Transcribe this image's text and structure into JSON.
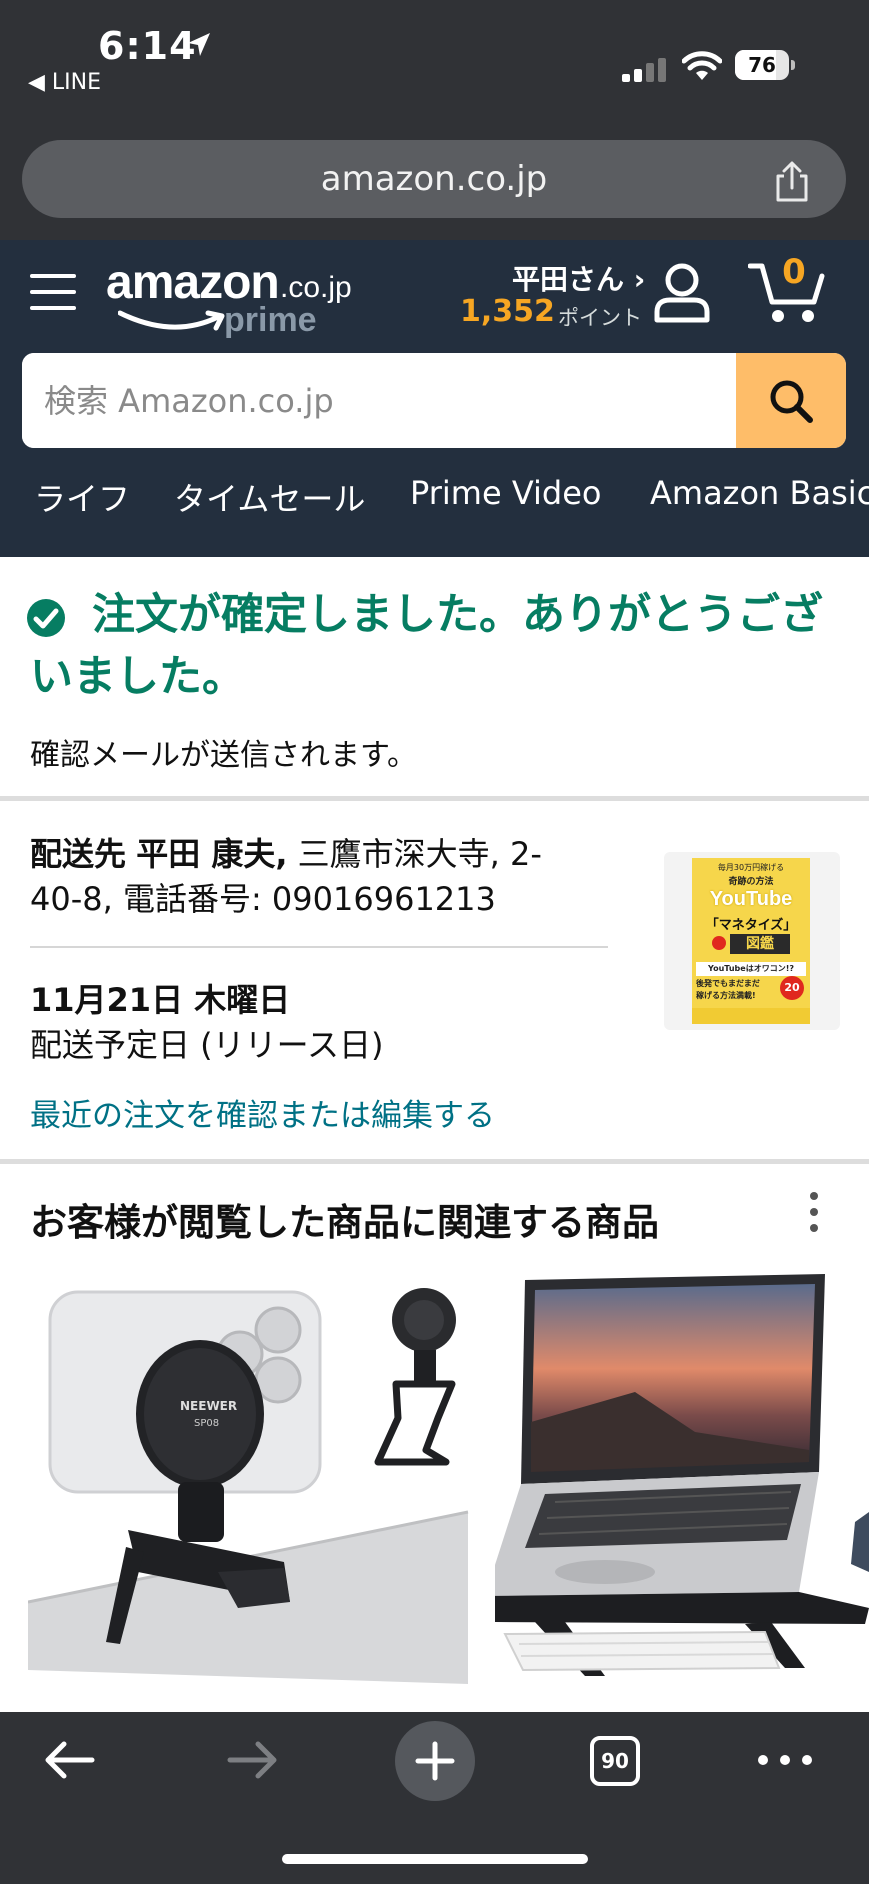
{
  "status_bar": {
    "time": "6:14",
    "back_app": "◀ LINE",
    "battery": "76"
  },
  "browser": {
    "url": "amazon.co.jp",
    "tab_count": "90"
  },
  "header": {
    "logo_main": "amazon",
    "logo_domain": ".co.jp",
    "logo_sub": "prime",
    "user_name": "平田さん ›",
    "points_value": "1,352",
    "points_label": "ポイント",
    "cart_count": "0"
  },
  "search": {
    "placeholder": "検索 Amazon.co.jp"
  },
  "nav": {
    "items": [
      "ライフ",
      "タイムセール",
      "Prime Video",
      "Amazon Basics"
    ]
  },
  "confirmation": {
    "title": "注文が確定しました。ありがとうございました。",
    "subtitle": "確認メールが送信されます。"
  },
  "delivery": {
    "label": "配送先",
    "name": "平田 康夫,",
    "address": "三鷹市深大寺, 2-40-8, 電話番号: 09016961213",
    "date": "11月21日 木曜日",
    "date_label": "配送予定日 (リリース日)",
    "edit_link": "最近の注文を確認または編集する"
  },
  "book": {
    "line1": "毎月30万円稼げる",
    "line2": "奇跡の方法",
    "line3": "YouTube",
    "line4": "「マネタイズ」",
    "line5": "図鑑",
    "line6": "YouTubeはオワコン!?",
    "line7": "後発でもまだまだ",
    "line8": "稼げる方法満載!",
    "badge": "20"
  },
  "related": {
    "title": "お客様が閲覧した商品に関連する商品",
    "product1_brand": "NEEWER",
    "product1_model": "SP08"
  }
}
